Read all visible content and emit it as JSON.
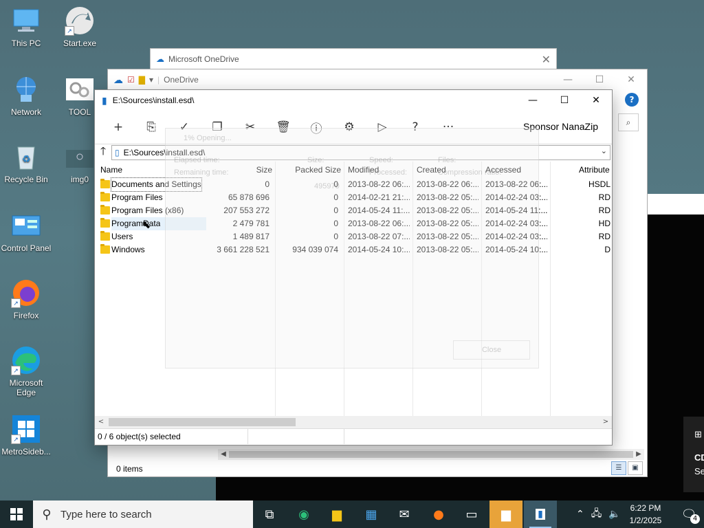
{
  "desktop": {
    "icons": [
      {
        "label": "This PC",
        "icon": "this-pc-icon"
      },
      {
        "label": "Start.exe",
        "icon": "start-exe-icon"
      },
      {
        "label": "Network",
        "icon": "network-icon"
      },
      {
        "label": "TOOL",
        "icon": "tool-icon"
      },
      {
        "label": "Recycle Bin",
        "icon": "recycle-bin-icon"
      },
      {
        "label": "img0",
        "icon": "image-icon"
      },
      {
        "label": "Control Panel",
        "icon": "control-panel-icon"
      },
      {
        "label": "Firefox",
        "icon": "firefox-icon"
      },
      {
        "label": "Microsoft Edge",
        "icon": "edge-icon"
      },
      {
        "label": "MetroSideb...",
        "icon": "metro-sidebar-icon"
      }
    ]
  },
  "onedrive_window": {
    "title": "Microsoft OneDrive",
    "close": "✕"
  },
  "explorer_window": {
    "title": "OneDrive",
    "minimize": "—",
    "maximize": "☐",
    "close": "✕",
    "help": "?",
    "search_icon": "⌕",
    "status": "0 items"
  },
  "ghost_dialog": {
    "title": "1% Opening...",
    "row1a": "Elapsed time:",
    "row1b": "Remaining time:",
    "col2a": "Size:",
    "col2b": "495970",
    "col3a": "Speed:",
    "col3b": "Processed:",
    "col4a": "Files:",
    "col4b": "Compression ratio:",
    "close": "Close"
  },
  "nanazip": {
    "title": "E:\\Sources\\install.esd\\",
    "minimize": "—",
    "maximize": "☐",
    "close": "✕",
    "toolbar": [
      "+",
      "⎘",
      "✓",
      "❐",
      "✂",
      "🗑",
      "ⓘ",
      "⚙",
      "▷",
      "?",
      "···"
    ],
    "sponsor": "Sponsor NanaZip",
    "up": "🡑",
    "address": "E:\\Sources\\install.esd\\",
    "columns": {
      "name": "Name",
      "size": "Size",
      "packed": "Packed Size",
      "modified": "Modified",
      "created": "Created",
      "accessed": "Accessed",
      "attributes": "Attribute"
    },
    "rows": [
      {
        "name": "Documents and Settings",
        "size": "0",
        "packed": "0",
        "modified": "2013-08-22 06:...",
        "created": "2013-08-22 06:...",
        "accessed": "2013-08-22 06:...",
        "attr": "HSDL"
      },
      {
        "name": "Program Files",
        "size": "65 878 696",
        "packed": "0",
        "modified": "2014-02-21 21:...",
        "created": "2013-08-22 05:...",
        "accessed": "2014-02-24 03:...",
        "attr": "RD"
      },
      {
        "name": "Program Files (x86)",
        "size": "207 553 272",
        "packed": "0",
        "modified": "2014-05-24 11:...",
        "created": "2013-08-22 05:...",
        "accessed": "2014-05-24 11:...",
        "attr": "RD"
      },
      {
        "name": "ProgramData",
        "size": "2 479 781",
        "packed": "0",
        "modified": "2013-08-22 06:...",
        "created": "2013-08-22 05:...",
        "accessed": "2014-02-24 03:...",
        "attr": "HD"
      },
      {
        "name": "Users",
        "size": "1 489 817",
        "packed": "0",
        "modified": "2013-08-22 07:...",
        "created": "2013-08-22 05:...",
        "accessed": "2014-02-24 03:...",
        "attr": "RD"
      },
      {
        "name": "Windows",
        "size": "3 661 228 521",
        "packed": "934 039 074",
        "modified": "2014-05-24 10:...",
        "created": "2013-08-22 05:...",
        "accessed": "2014-05-24 10:...",
        "attr": "D"
      }
    ],
    "status": "0 / 6 object(s) selected"
  },
  "toast": {
    "line1": "CD",
    "line2": "Se"
  },
  "taskbar": {
    "search_placeholder": "Type here to search",
    "time": "6:22 PM",
    "date": "1/2/2025",
    "notification_count": "4"
  },
  "colors": {
    "accent": "#1a6fc4",
    "folder": "#f5c518",
    "taskbar": "#1b2b2f",
    "active_task": "#e8a33a"
  }
}
